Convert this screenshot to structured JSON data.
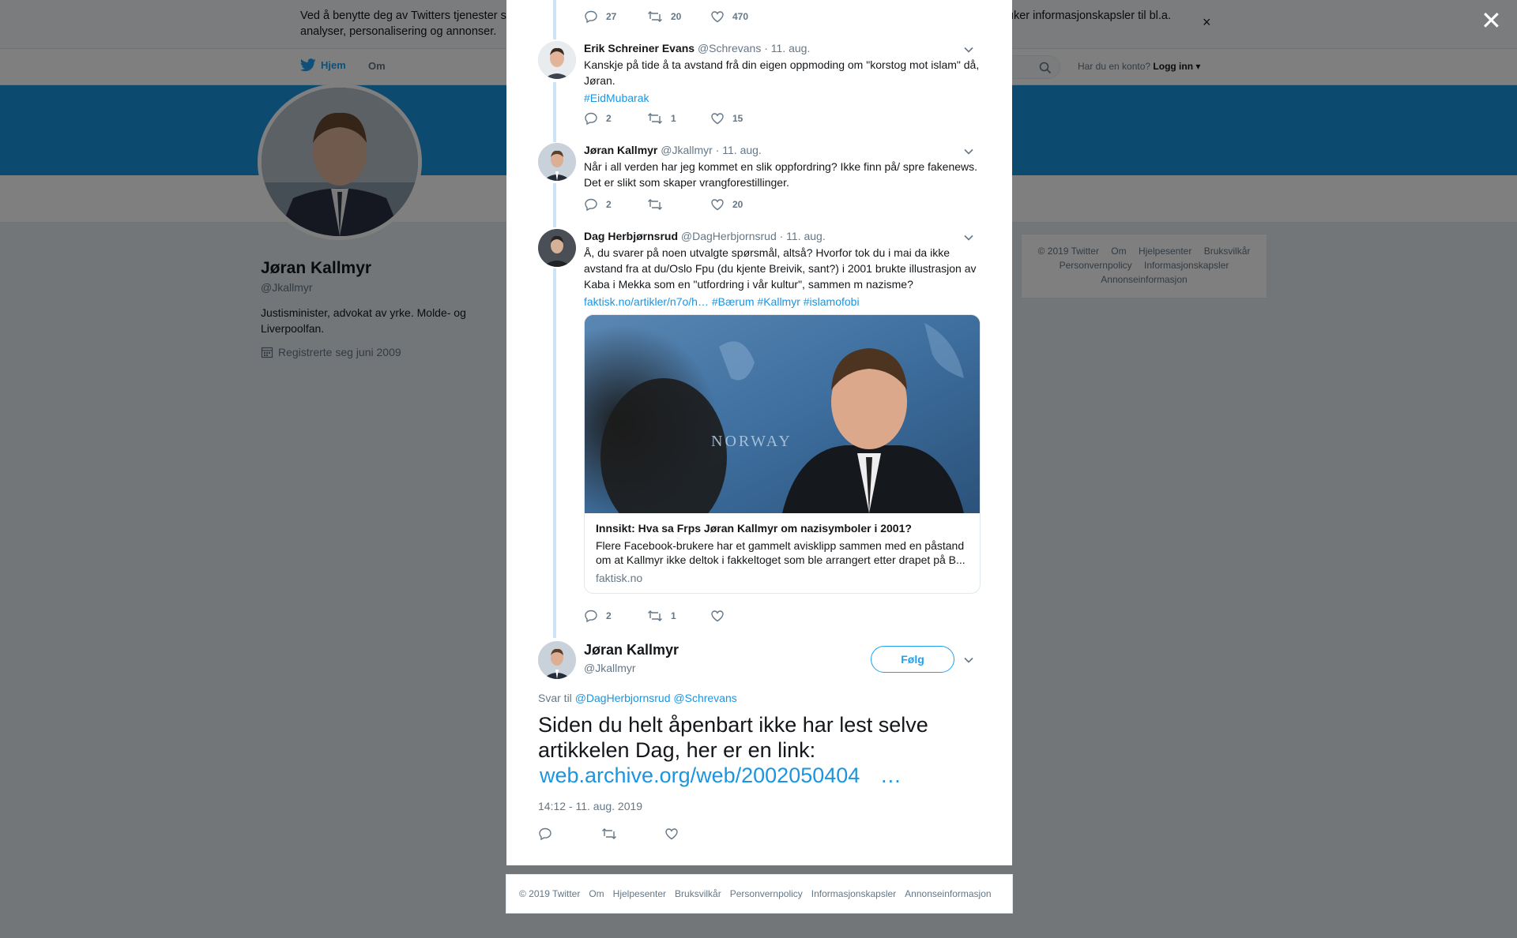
{
  "cookie_banner": {
    "text": "Ved å benytte deg av Twitters tjenester samtykker du i vår bruk av informasjonskapsler og dataoverføring utenfor EU. Vi og våre partnere bruker informasjonskapsler til bl.a. analyser, personalisering og annonser."
  },
  "nav": {
    "home": "Hjem",
    "about": "Om",
    "login_question": "Har du en konto?",
    "login": "Logg inn"
  },
  "profile": {
    "name": "Jøran Kallmyr",
    "handle": "@Jkallmyr",
    "bio": "Justisminister, advokat av yrke. Molde- og Liverpoolfan.",
    "joined": "Registrerte seg juni 2009"
  },
  "sidebar_footer": [
    "© 2019 Twitter",
    "Om",
    "Hjelpesenter",
    "Bruksvilkår",
    "Personvernpolicy",
    "Informasjonskapsler",
    "Annonseinformasjon"
  ],
  "thread": [
    {
      "actions": {
        "replies": "27",
        "retweets": "20",
        "likes": "470"
      }
    },
    {
      "name": "Erik Schreiner Evans",
      "handle": "@Schrevans",
      "date": "· 11. aug.",
      "text": "Kanskje på tide å ta avstand frå din eigen oppmoding om \"korstog mot islam\" då, Jøran.",
      "links": "#EidMubarak",
      "actions": {
        "replies": "2",
        "retweets": "1",
        "likes": "15"
      }
    },
    {
      "name": "Jøran Kallmyr",
      "handle": "@Jkallmyr",
      "date": "· 11. aug.",
      "text": "Når i all verden har jeg kommet en slik oppfordring? Ikke finn på/ spre fakenews. Det er slikt som skaper vrangforestillinger.",
      "actions": {
        "replies": "2",
        "retweets": "",
        "likes": "20"
      }
    },
    {
      "name": "Dag Herbjørnsrud",
      "handle": "@DagHerbjornsrud",
      "date": "· 11. aug.",
      "text": "Å, du svarer på noen utvalgte spørsmål, altså? Hvorfor tok du i mai da ikke avstand fra at du/Oslo Fpu (du kjente Breivik, sant?) i 2001 brukte illustrasjon av Kaba i Mekka som en \"utfordring i vår kultur\", sammen m nazisme?",
      "links": "faktisk.no/artikler/n7o/h… #Bærum #Kallmyr #islamofobi",
      "card": {
        "title": "Innsikt: Hva sa Frps Jøran Kallmyr om nazisymboler i 2001?",
        "description": "Flere Facebook-brukere har et gammelt avisklipp sammen med en påstand om at Kallmyr ikke deltok i fakkeltoget som ble arrangert etter drapet på B...",
        "domain": "faktisk.no",
        "image_text": "NORWAY"
      },
      "actions": {
        "replies": "2",
        "retweets": "1",
        "likes": ""
      }
    }
  ],
  "main_tweet": {
    "name": "Jøran Kallmyr",
    "handle": "@Jkallmyr",
    "follow": "Følg",
    "reply_prefix": "Svar til",
    "reply_to": "@DagHerbjornsrud @Schrevans",
    "text": "Siden du helt åpenbart ikke har lest selve artikkelen Dag, her er en link:",
    "link": "web.archive.org/web/2002050404",
    "ellipsis": "…",
    "timestamp": "14:12 - 11. aug. 2019"
  },
  "modal_footer": [
    "© 2019 Twitter",
    "Om",
    "Hjelpesenter",
    "Bruksvilkår",
    "Personvernpolicy",
    "Informasjonskapsler",
    "Annonseinformasjon"
  ],
  "colors": {
    "accent": "#1da1f2",
    "link": "#1b95e0",
    "banner": "#1b95e0",
    "thread_line": "#cce4f5"
  },
  "icons": [
    "close-icon",
    "twitter-bird-icon",
    "search-icon",
    "calendar-icon",
    "reply-icon",
    "retweet-icon",
    "like-icon",
    "chevron-down-icon"
  ]
}
